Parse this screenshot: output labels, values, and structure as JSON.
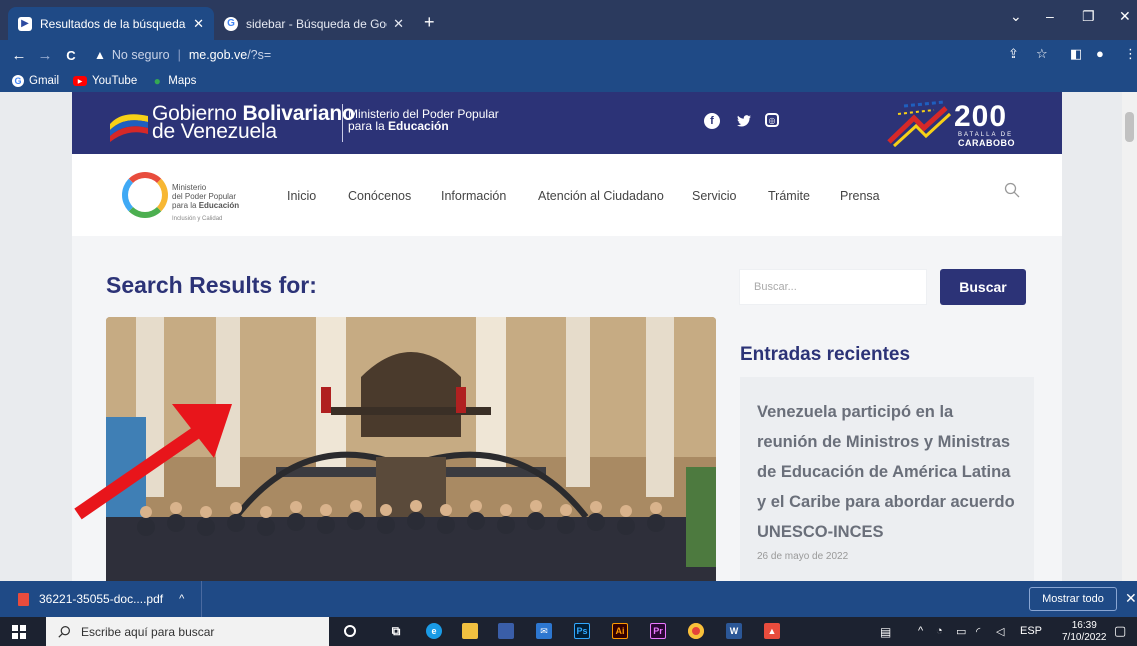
{
  "browser": {
    "tabs": [
      {
        "title": "Resultados de la búsqueda de «",
        "close": "✕",
        "active": true
      },
      {
        "title": "sidebar - Búsqueda de Google",
        "close": "✕",
        "active": false
      }
    ],
    "new_tab": "+",
    "window_controls": {
      "chevron": "⌄",
      "minimize": "–",
      "restore": "❐",
      "close": "✕"
    },
    "nav": {
      "back": "←",
      "forward": "→",
      "reload": "C"
    },
    "address": {
      "security_label": "No seguro",
      "warning": "▲",
      "host": "me.gob.ve",
      "path": "/?s="
    },
    "toolbar_icons": {
      "share": "⇪",
      "star": "☆",
      "sidepanel": "◧",
      "profile": "●",
      "menu": "⋮"
    },
    "bookmarks": [
      {
        "label": "Gmail",
        "icon": "google-icon"
      },
      {
        "label": "YouTube",
        "icon": "youtube-icon"
      },
      {
        "label": "Maps",
        "icon": "maps-icon"
      }
    ]
  },
  "site": {
    "gov_name_line1_a": "Gobierno ",
    "gov_name_line1_b": "Bolivariano",
    "gov_name_line2": "de Venezuela",
    "ministry_line1": "Ministerio del Poder Popular",
    "ministry_line2_a": "para la ",
    "ministry_line2_b": "Educación",
    "social": {
      "facebook": "f",
      "twitter": "🐦",
      "instagram": "◎"
    },
    "badge": {
      "number": "200",
      "line1": "BATALLA DE",
      "line2": "CARABOBO"
    },
    "logo_text": {
      "line1": "Ministerio",
      "line2": "del Poder Popular",
      "line3_a": "para la ",
      "line3_b": "Educación",
      "tagline": "Inclusión y Calidad"
    },
    "menu": [
      "Inicio",
      "Conócenos",
      "Información",
      "Atención al Ciudadano",
      "Servicio",
      "Trámite",
      "Prensa"
    ],
    "main_title": "Search Results for:",
    "search": {
      "placeholder": "Buscar...",
      "button": "Buscar"
    },
    "recent": {
      "title": "Entradas recientes",
      "link": "Venezuela participó en la reunión de Ministros y Ministras de Educación de América Latina y el Caribe para abordar acuerdo UNESCO-INCES",
      "date": "26 de mayo de 2022"
    }
  },
  "download": {
    "file": "36221-35055-doc....pdf",
    "chevron": "^",
    "show_all": "Mostrar todo",
    "close": "✕"
  },
  "taskbar": {
    "search_placeholder": "Escribe aquí para buscar",
    "tray": {
      "chevron": "^",
      "language": "ESP"
    },
    "time": "16:39",
    "date": "7/10/2022"
  },
  "colors": {
    "gov_blue": "#2c3377",
    "chrome_blue": "#1f4a86",
    "arrow_red": "#e8151b"
  }
}
